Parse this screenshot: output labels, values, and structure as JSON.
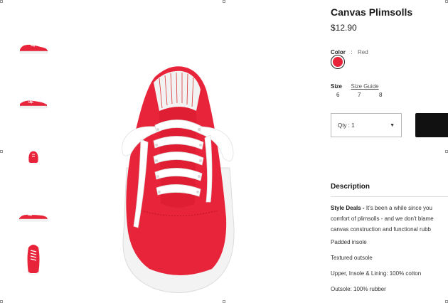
{
  "product": {
    "title": "Canvas Plimsolls",
    "price": "$12.90"
  },
  "color": {
    "label": "Color",
    "separator": ":",
    "value": "Red",
    "swatch_hex": "#e8243a"
  },
  "size": {
    "label": "Size",
    "guide_label": "Size Guide",
    "options": [
      "6",
      "7",
      "8"
    ]
  },
  "quantity": {
    "label": "Qty : 1",
    "caret": "▼"
  },
  "description": {
    "title": "Description",
    "lead_bold": "Style Deals - ",
    "lead_line1": "It's been a while since you",
    "line2": "comfort of plimsolls - and we don't blame",
    "line3": "canvas construction and functional rubb",
    "features": [
      "Padded insole",
      "Textured outsole",
      "Upper, Insole & Lining: 100% cotton",
      "Outsole: 100% rubber"
    ]
  },
  "thumbnails": [
    {
      "name": "thumb-side-view"
    },
    {
      "name": "thumb-angled-view"
    },
    {
      "name": "thumb-front-view"
    },
    {
      "name": "thumb-side-view-2"
    },
    {
      "name": "thumb-top-view"
    }
  ],
  "colors": {
    "shoe_red": "#e8243a",
    "button_black": "#111111"
  }
}
